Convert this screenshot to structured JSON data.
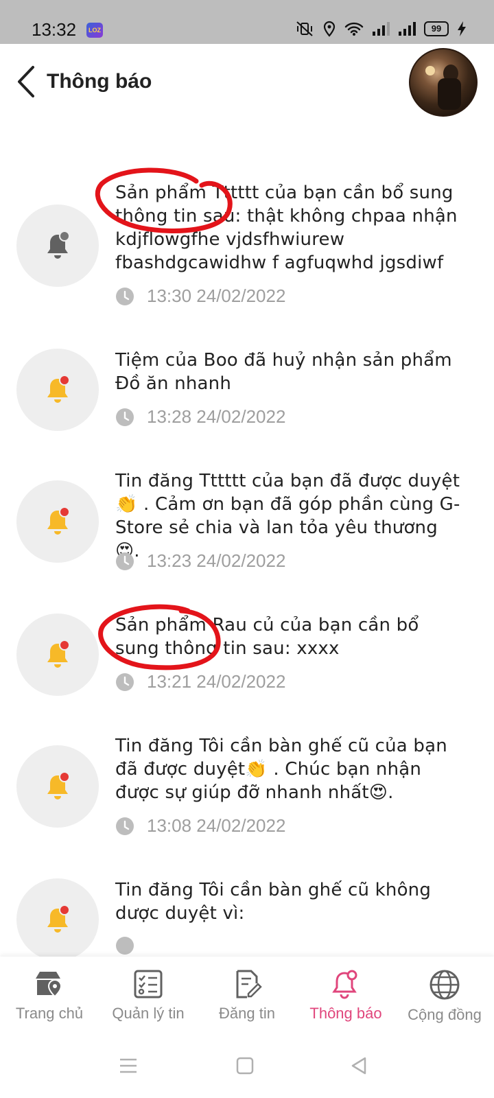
{
  "status_bar": {
    "time": "13:32",
    "app_badge": "LOZ",
    "battery": "99",
    "icons": [
      "mute-vibrate-icon",
      "location-icon",
      "wifi-icon",
      "signal-icon",
      "signal-icon",
      "battery-icon",
      "charging-icon"
    ]
  },
  "header": {
    "back_icon": "chevron-left-icon",
    "title": "Thông báo"
  },
  "notifications": [
    {
      "text": "Sản phẩm Tttttt của bạn cần bổ sung thông tin sau: thật không chpaa nhận kdjflowgfhe vjdsfhwiurew fbashdgcawidhw f agfuqwhd jgsdiwf",
      "time": "13:30 24/02/2022",
      "unread": false,
      "annotated": true
    },
    {
      "text": "Tiệm của Boo đã huỷ nhận sản phẩm Đồ ăn nhanh",
      "time": "13:28 24/02/2022",
      "unread": true,
      "annotated": false
    },
    {
      "text": "Tin đăng Tttttt của bạn đã được duyệt 👏 . Cảm ơn bạn đã góp phần cùng G-Store sẻ chia và lan tỏa yêu thương 😍.",
      "time": "13:23 24/02/2022",
      "unread": true,
      "annotated": false
    },
    {
      "text": "Sản phẩm Rau củ của bạn cần bổ sung thông tin sau: xxxx",
      "time": "13:21 24/02/2022",
      "unread": true,
      "annotated": true
    },
    {
      "text": "Tin đăng Tôi cần bàn ghế cũ của bạn đã được duyệt👏 . Chúc bạn nhận được sự giúp đỡ nhanh nhất😍.",
      "time": "13:08 24/02/2022",
      "unread": true,
      "annotated": false
    },
    {
      "text": "Tin đăng Tôi cần bàn ghế cũ không dược duyệt vì:",
      "time": "",
      "unread": true,
      "annotated": false
    }
  ],
  "bottom_nav": {
    "items": [
      {
        "label": "Trang chủ",
        "icon": "store-location-icon",
        "active": false
      },
      {
        "label": "Quản lý tin",
        "icon": "checklist-icon",
        "active": false
      },
      {
        "label": "Đăng tin",
        "icon": "edit-document-icon",
        "active": false
      },
      {
        "label": "Thông báo",
        "icon": "bell-icon",
        "active": true
      },
      {
        "label": "Cộng đồng",
        "icon": "globe-icon",
        "active": false
      }
    ]
  },
  "colors": {
    "accent": "#e0467c",
    "bell_active": "#f7b928",
    "badge_red": "#e53935",
    "bell_read": "#616161",
    "icon_bg": "#eeeeee",
    "scribble": "#e3141a"
  }
}
